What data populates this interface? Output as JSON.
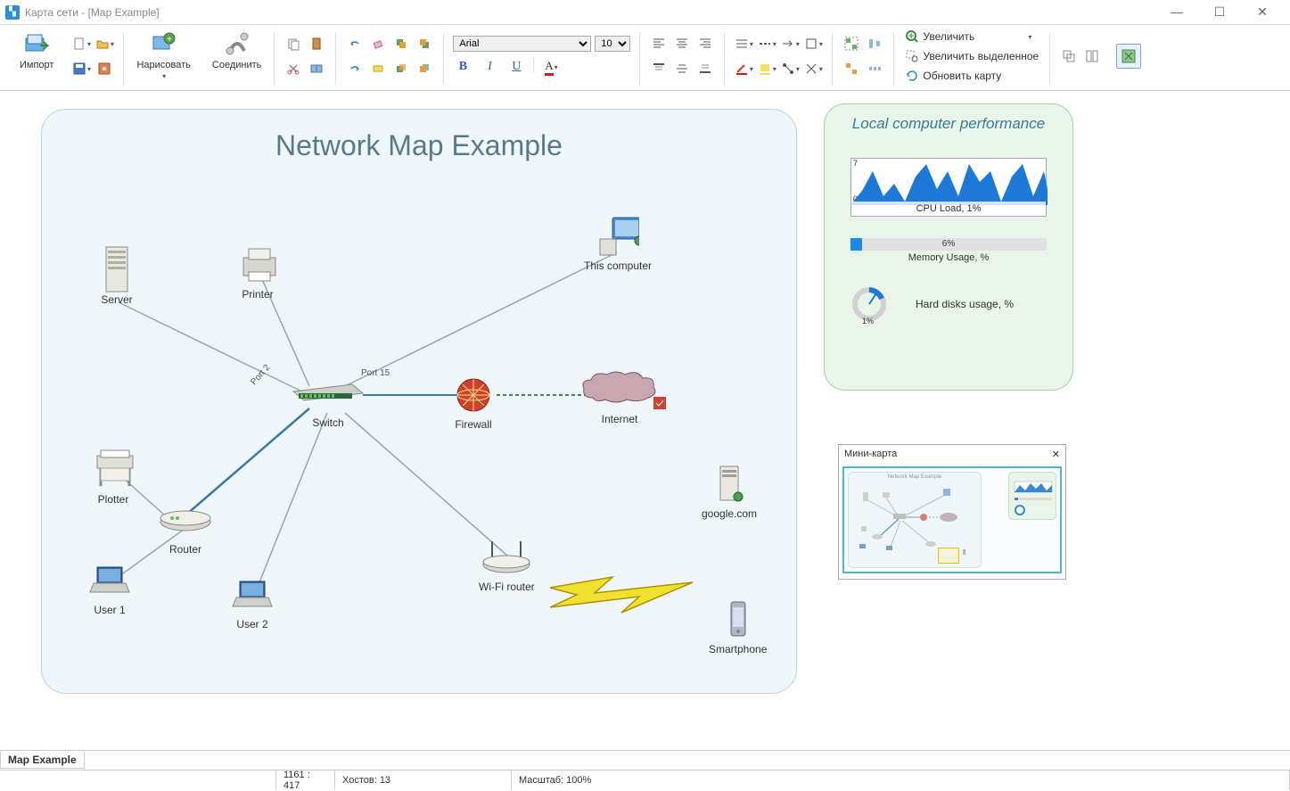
{
  "window": {
    "title": "Карта сети - [Map Example]",
    "minimize": "—",
    "maximize": "☐",
    "close": "✕"
  },
  "toolbar": {
    "import": "Импорт",
    "draw": "Нарисовать",
    "connect": "Соединить",
    "font_name": "Arial",
    "font_size": "10",
    "zoom_in": "Увеличить",
    "zoom_selection": "Увеличить выделенное",
    "refresh_map": "Обновить карту"
  },
  "map": {
    "title": "Network Map Example",
    "nodes": {
      "server": "Server",
      "printer": "Printer",
      "this_computer": "This computer",
      "switch": "Switch",
      "firewall": "Firewall",
      "internet": "Internet",
      "plotter": "Plotter",
      "router": "Router",
      "google": "google.com",
      "user1": "User 1",
      "user2": "User 2",
      "wifi_router": "Wi-Fi router",
      "smartphone": "Smartphone"
    },
    "port_labels": {
      "port2": "Port 2",
      "port15": "Port 15"
    }
  },
  "perf": {
    "title": "Local computer performance",
    "cpu_label": "CPU Load, 1%",
    "cpu_axis_max": "7",
    "cpu_axis_min": "0",
    "mem_pct": "6%",
    "mem_label": "Memory Usage, %",
    "disk_pct": "1%",
    "disk_label": "Hard disks usage, %"
  },
  "minimap": {
    "title": "Мини-карта",
    "close": "✕",
    "thumb_title": "Network Map Example"
  },
  "tabs": {
    "map_example": "Map Example"
  },
  "status": {
    "coords": "1161 : 417",
    "hosts": "Хостов: 13",
    "scale": "Масштаб: 100%"
  },
  "chart_data": {
    "type": "area",
    "title": "CPU Load, 1%",
    "ylabel": "",
    "ylim": [
      0,
      7
    ],
    "x": [
      0,
      1,
      2,
      3,
      4,
      5,
      6,
      7,
      8,
      9,
      10,
      11,
      12,
      13,
      14,
      15,
      16,
      17,
      18,
      19
    ],
    "values": [
      1,
      3,
      6,
      2,
      4,
      1,
      5,
      7,
      3,
      6,
      2,
      7,
      4,
      6,
      1,
      5,
      7,
      2,
      6,
      3
    ]
  }
}
